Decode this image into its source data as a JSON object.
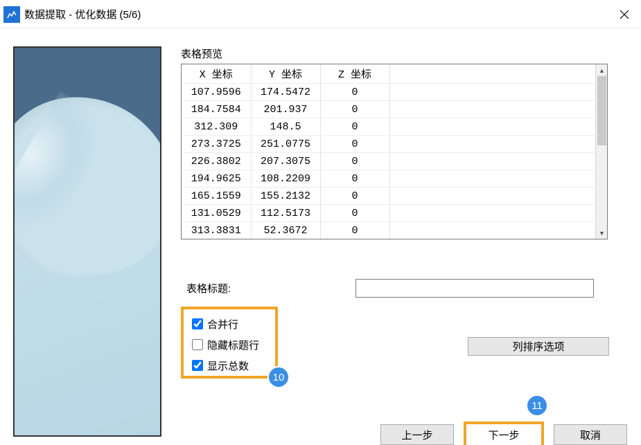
{
  "window": {
    "title": "数据提取 - 优化数据 (5/6)"
  },
  "preview": {
    "heading": "表格预览",
    "columns": [
      "X 坐标",
      "Y 坐标",
      "Z 坐标"
    ],
    "rows": [
      [
        "107.9596",
        "174.5472",
        "0"
      ],
      [
        "184.7584",
        "201.937",
        "0"
      ],
      [
        "312.309",
        "148.5",
        "0"
      ],
      [
        "273.3725",
        "251.0775",
        "0"
      ],
      [
        "226.3802",
        "207.3075",
        "0"
      ],
      [
        "194.9625",
        "108.2209",
        "0"
      ],
      [
        "165.1559",
        "155.2132",
        "0"
      ],
      [
        "131.0529",
        "112.5173",
        "0"
      ],
      [
        "313.3831",
        "52.3672",
        "0"
      ]
    ]
  },
  "form": {
    "title_label": "表格标题:",
    "title_value": "",
    "checks": {
      "merge_rows": {
        "label": "合并行",
        "checked": true
      },
      "hide_header": {
        "label": "隐藏标题行",
        "checked": false
      },
      "show_totals": {
        "label": "显示总数",
        "checked": true
      }
    },
    "column_sort_btn": "列排序选项"
  },
  "nav": {
    "prev": "上一步",
    "next": "下一步",
    "cancel": "取消"
  },
  "badges": {
    "b10": "10",
    "b11": "11"
  }
}
